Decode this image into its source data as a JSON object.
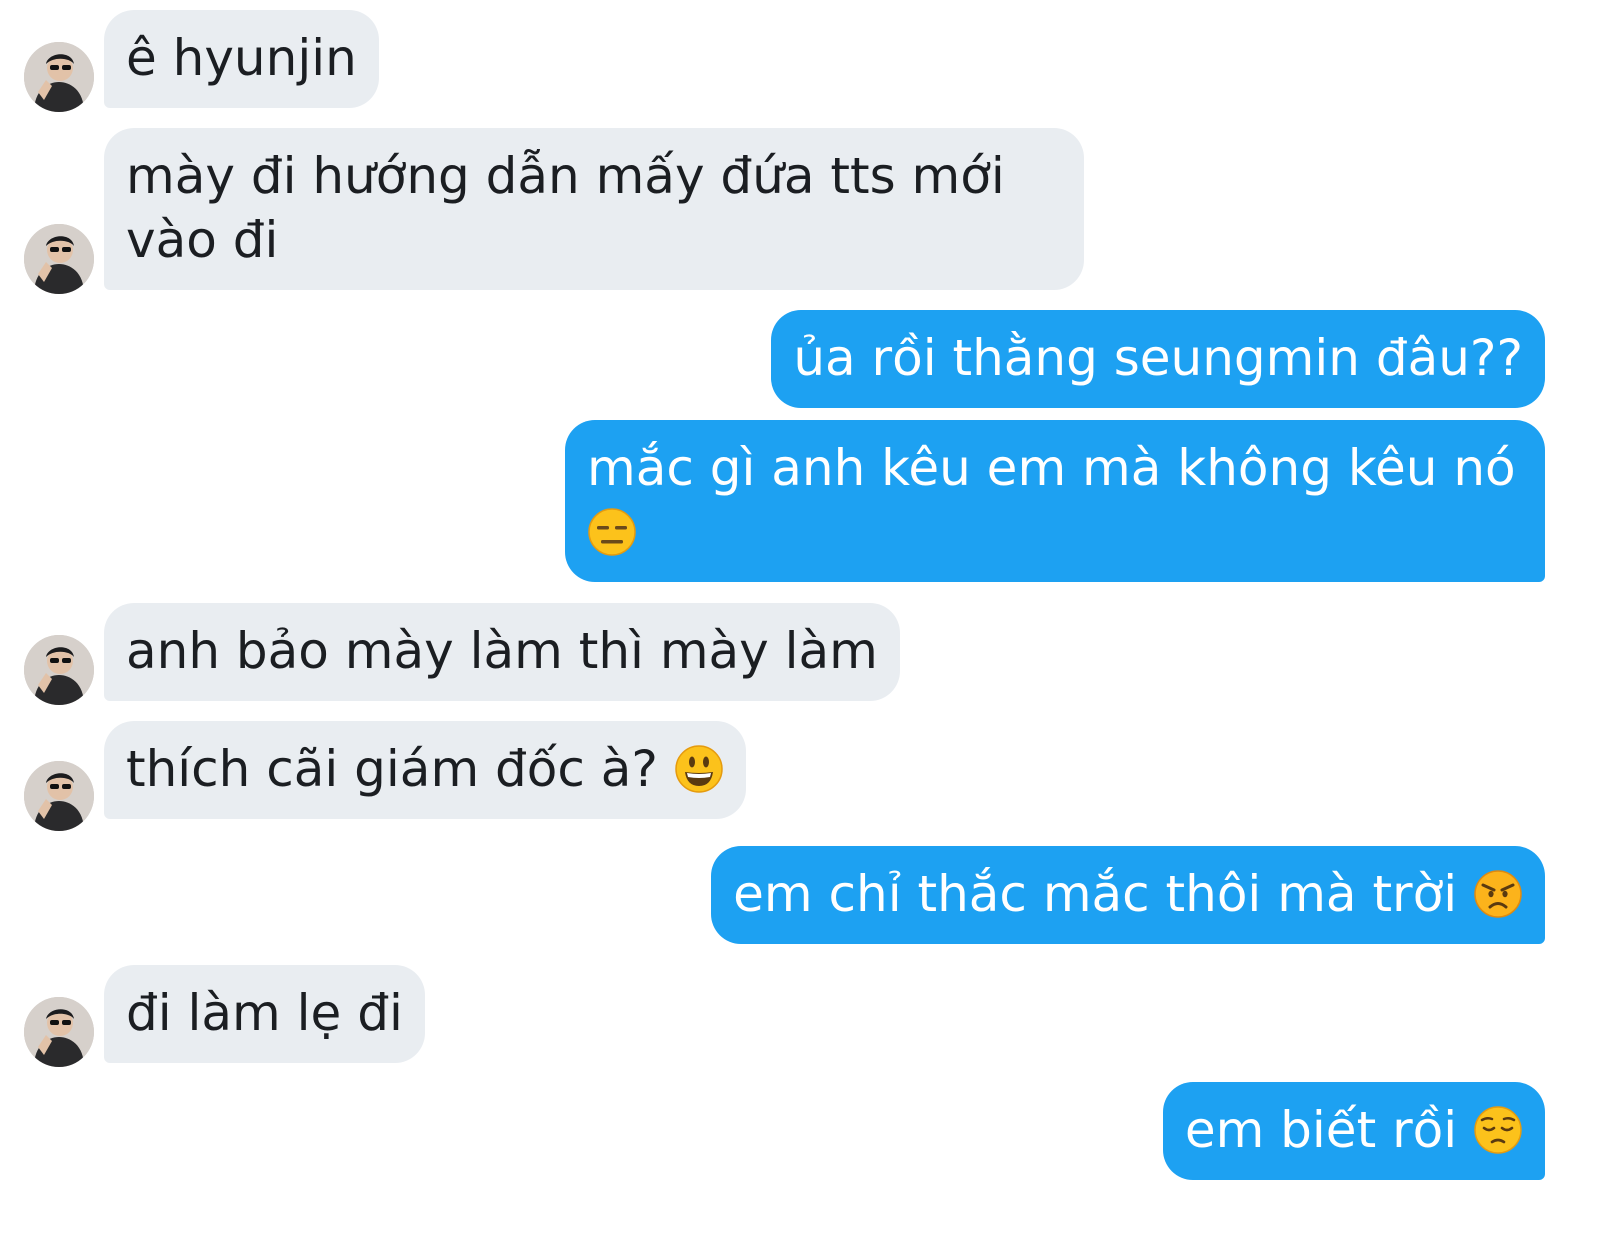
{
  "conversation": {
    "messages": [
      {
        "id": "m1",
        "direction": "incoming",
        "lines": [
          "ê hyunjin"
        ]
      },
      {
        "id": "m2",
        "direction": "incoming",
        "lines": [
          "mày đi hướng dẫn mấy đứa tts mới",
          "vào đi"
        ]
      },
      {
        "id": "m3",
        "direction": "outgoing",
        "lines": [
          "ủa rồi thằng seungmin đâu??"
        ]
      },
      {
        "id": "m4",
        "direction": "outgoing",
        "lines": [
          "mắc gì anh kêu em mà không kêu nó",
          ""
        ],
        "emoji": "expressionless-face-icon"
      },
      {
        "id": "m5",
        "direction": "incoming",
        "lines": [
          "anh bảo mày làm thì mày làm"
        ]
      },
      {
        "id": "m6",
        "direction": "incoming",
        "lines": [
          "thích cãi giám đốc à? "
        ],
        "emoji": "smiley-face-icon"
      },
      {
        "id": "m7",
        "direction": "outgoing",
        "lines": [
          "em chỉ thắc mắc thôi mà trời "
        ],
        "emoji": "angry-face-icon"
      },
      {
        "id": "m8",
        "direction": "incoming",
        "lines": [
          "đi làm lẹ đi"
        ]
      },
      {
        "id": "m9",
        "direction": "outgoing",
        "lines": [
          "em biết rồi "
        ],
        "emoji": "pensive-face-icon"
      }
    ]
  },
  "colors": {
    "incoming_bubble": "#e9edf1",
    "outgoing_bubble": "#1da1f2",
    "incoming_text": "#1b1e22",
    "outgoing_text": "#ffffff"
  }
}
